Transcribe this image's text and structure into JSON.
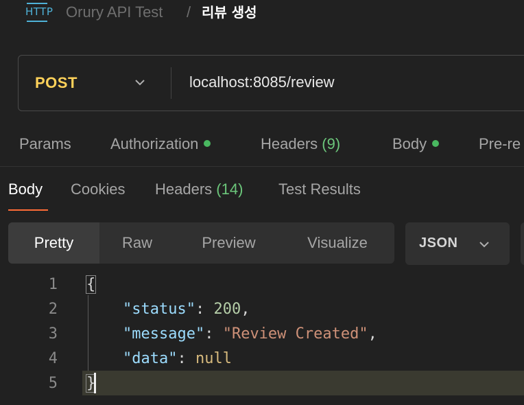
{
  "breadcrumb": {
    "icon_text": "HTTP",
    "collection": "Orury API Test",
    "separator": "/",
    "request_name": "리뷰 생성"
  },
  "request": {
    "method": "POST",
    "url": "localhost:8085/review"
  },
  "request_tabs": [
    {
      "label": "Params"
    },
    {
      "label": "Authorization",
      "dot": true
    },
    {
      "label": "Headers",
      "count": "(9)"
    },
    {
      "label": "Body",
      "dot": true
    },
    {
      "label": "Pre-re"
    }
  ],
  "response_tabs": [
    {
      "label": "Body",
      "active": true
    },
    {
      "label": "Cookies"
    },
    {
      "label": "Headers",
      "count": "(14)"
    },
    {
      "label": "Test Results"
    }
  ],
  "view_modes": [
    {
      "label": "Pretty",
      "active": true
    },
    {
      "label": "Raw"
    },
    {
      "label": "Preview"
    },
    {
      "label": "Visualize"
    }
  ],
  "format": "JSON",
  "code": {
    "line_numbers": [
      "1",
      "2",
      "3",
      "4",
      "5"
    ],
    "open_brace": "{",
    "close_brace": "}",
    "colon": ": ",
    "comma": ",",
    "lines": [
      {
        "key": "\"status\"",
        "value": "200",
        "value_type": "number",
        "comma": true
      },
      {
        "key": "\"message\"",
        "value": "\"Review Created\"",
        "value_type": "string",
        "comma": true
      },
      {
        "key": "\"data\"",
        "value": "null",
        "value_type": "null",
        "comma": false
      }
    ]
  },
  "colors": {
    "method": "#ffd25a",
    "accent": "#ff6c37",
    "status_dot": "#49b860",
    "http_icon": "#4fb2d8"
  }
}
